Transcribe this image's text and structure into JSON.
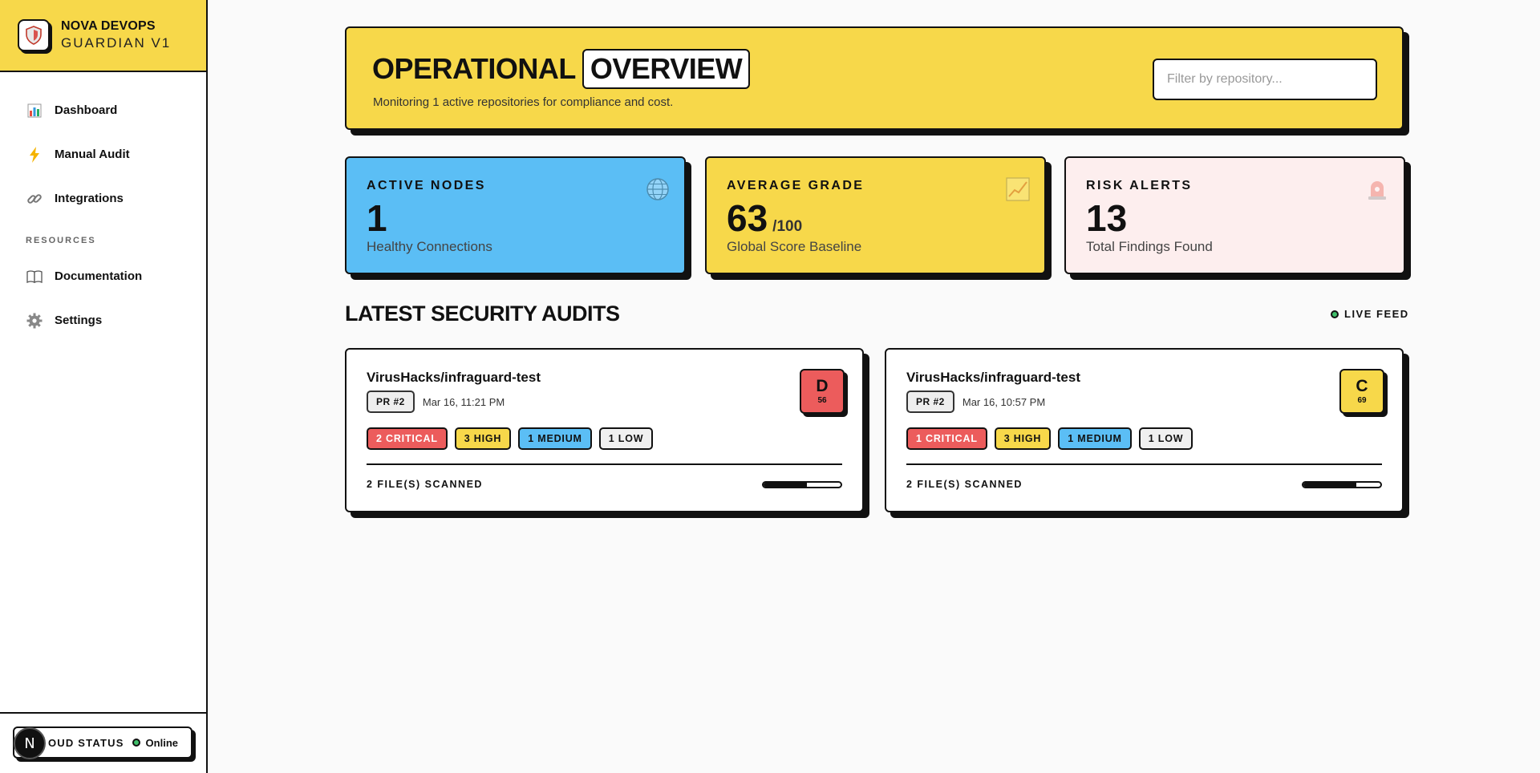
{
  "brand": {
    "line1": "NOVA DEVOPS",
    "line2": "GUARDIAN V1"
  },
  "nav": {
    "items": [
      {
        "label": "Dashboard",
        "icon": "bar-chart-icon"
      },
      {
        "label": "Manual Audit",
        "icon": "lightning-icon"
      },
      {
        "label": "Integrations",
        "icon": "link-icon"
      }
    ],
    "section": "RESOURCES",
    "resources": [
      {
        "label": "Documentation",
        "icon": "book-icon"
      },
      {
        "label": "Settings",
        "icon": "gear-icon"
      }
    ]
  },
  "cloud_status": {
    "label": "OUD STATUS",
    "state": "Online"
  },
  "avatar": {
    "initial": "N"
  },
  "hero": {
    "title_left": "OPERATIONAL",
    "title_right": "OVERVIEW",
    "subtitle": "Monitoring 1 active repositories for compliance and cost.",
    "search_placeholder": "Filter by repository..."
  },
  "stats": [
    {
      "label": "ACTIVE NODES",
      "value": "1",
      "unit": "",
      "caption": "Healthy Connections",
      "icon": "globe-icon",
      "color": "#5bbef5"
    },
    {
      "label": "AVERAGE GRADE",
      "value": "63",
      "unit": "/100",
      "caption": "Global Score Baseline",
      "icon": "trend-chart-icon",
      "color": "#f7d84a"
    },
    {
      "label": "RISK ALERTS",
      "value": "13",
      "unit": "",
      "caption": "Total Findings Found",
      "icon": "siren-icon",
      "color": "#fdeeee"
    }
  ],
  "audits_section": {
    "title": "LATEST SECURITY AUDITS",
    "live_label": "LIVE FEED"
  },
  "audits": [
    {
      "repo": "VirusHacks/infraguard-test",
      "pr": "PR #2",
      "date": "Mar 16, 11:21 PM",
      "grade": "D",
      "score": "56",
      "grade_color": "#ec5c5c",
      "critical": "2 CRITICAL",
      "high": "3 HIGH",
      "medium": "1 MEDIUM",
      "low": "1 LOW",
      "files": "2 FILE(S) SCANNED",
      "progress": 0.56
    },
    {
      "repo": "VirusHacks/infraguard-test",
      "pr": "PR #2",
      "date": "Mar 16, 10:57 PM",
      "grade": "C",
      "score": "69",
      "grade_color": "#f7d84a",
      "critical": "1 CRITICAL",
      "high": "3 HIGH",
      "medium": "1 MEDIUM",
      "low": "1 LOW",
      "files": "2 FILE(S) SCANNED",
      "progress": 0.69
    }
  ]
}
